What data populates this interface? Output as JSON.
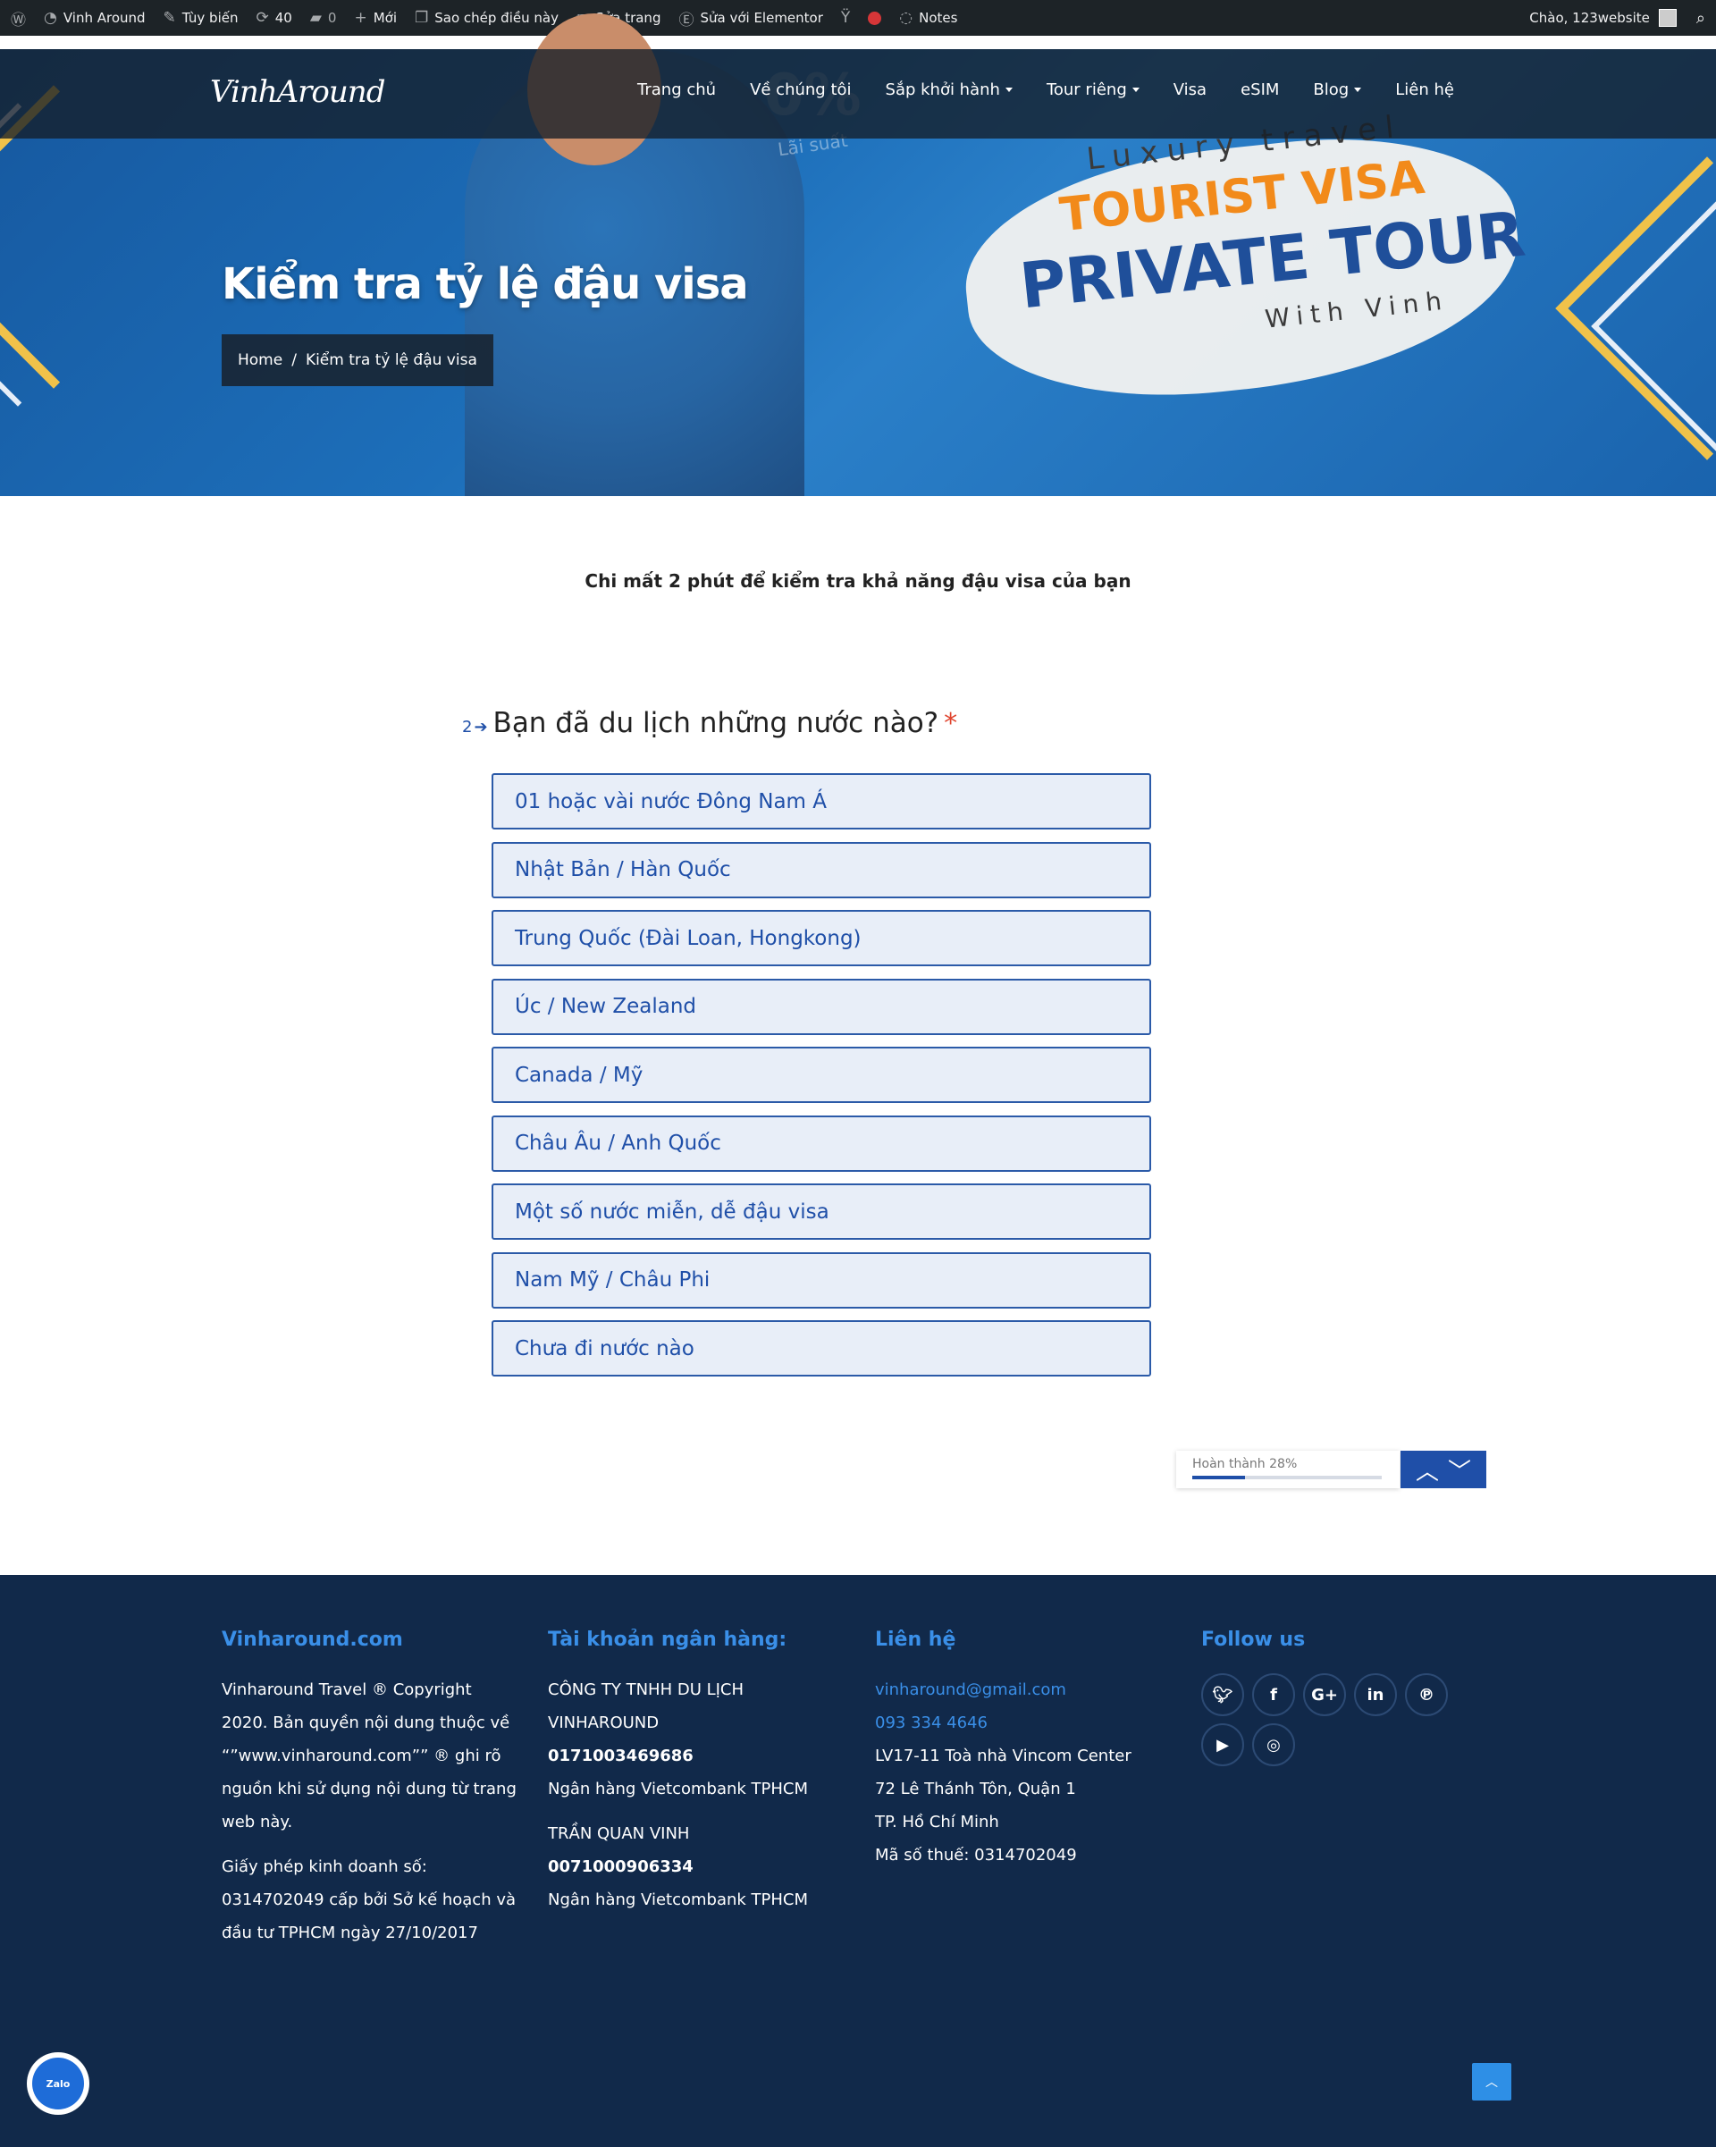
{
  "adminbar": {
    "site_name": "Vinh Around",
    "customize": "Tùy biến",
    "updates_count": "40",
    "comments_count": "0",
    "new_label": "Mới",
    "copy_label": "Sao chép điều này",
    "edit_page": "Sửa trang",
    "edit_elementor": "Sửa với Elementor",
    "notes": "Notes",
    "greeting": "Chào, 123website"
  },
  "header": {
    "logo": "VinhAround",
    "nav": [
      "Trang chủ",
      "Về chúng tôi",
      "Sắp khởi hành",
      "Tour riêng",
      "Visa",
      "eSIM",
      "Blog",
      "Liên hệ"
    ]
  },
  "hero": {
    "title": "Kiểm tra tỷ lệ đậu visa",
    "breadcrumb": [
      "Home",
      "/",
      "Kiểm tra tỷ lệ đậu visa"
    ],
    "promo": {
      "luxury": "Luxury travel",
      "tourist_visa": "TOURIST VISA",
      "private_tour": "PRIVATE TOUR",
      "with": "With Vinh",
      "zero_percent": "0%",
      "lai_suat": "Lãi suất"
    }
  },
  "intro": "Chi mất 2 phút để kiểm tra khả năng đậu visa của bạn",
  "form": {
    "question_number": "2",
    "question": "Bạn đã du lịch những nước nào?",
    "required_mark": "*",
    "options": [
      "01 hoặc vài nước Đông Nam Á",
      "Nhật Bản / Hàn Quốc",
      "Trung Quốc (Đài Loan, Hongkong)",
      "Úc / New Zealand",
      "Canada / Mỹ",
      "Châu Âu / Anh Quốc",
      "Một số nước miễn, dễ đậu visa",
      "Nam Mỹ / Châu Phi",
      "Chưa đi nước nào"
    ],
    "progress_label": "Hoàn thành 28%",
    "progress_value": 0.28
  },
  "footer": {
    "col1": {
      "title": "Vinharound.com",
      "text1": "Vinharound Travel ® Copyright 2020. Bản quyền nội dung thuộc về “”www.vinharound.com”” ® ghi rõ nguồn khi sử dụng nội dung từ trang web này.",
      "text2": "Giấy phép kinh doanh số: 0314702049 cấp bởi Sở kế hoạch và đầu tư TPHCM ngày 27/10/2017"
    },
    "col2": {
      "title": "Tài khoản ngân hàng:",
      "company": "CÔNG TY TNHH DU LỊCH VINHAROUND",
      "account1": "0171003469686",
      "bank1": "Ngân hàng Vietcombank TPHCM",
      "person": "TRẦN QUAN VINH",
      "account2": "0071000906334",
      "bank2": "Ngân hàng Vietcombank TPHCM"
    },
    "col3": {
      "title": "Liên hệ",
      "email": "vinharound@gmail.com",
      "phone": "093 334 4646",
      "addr1": "LV17-11 Toà nhà Vincom Center",
      "addr2": "72 Lê Thánh Tôn, Quận 1",
      "addr3": "TP. Hồ Chí Minh",
      "tax": "Mã số thuế: 0314702049"
    },
    "col4": {
      "title": "Follow us"
    }
  },
  "widgets": {
    "zalo": "Zalo"
  }
}
